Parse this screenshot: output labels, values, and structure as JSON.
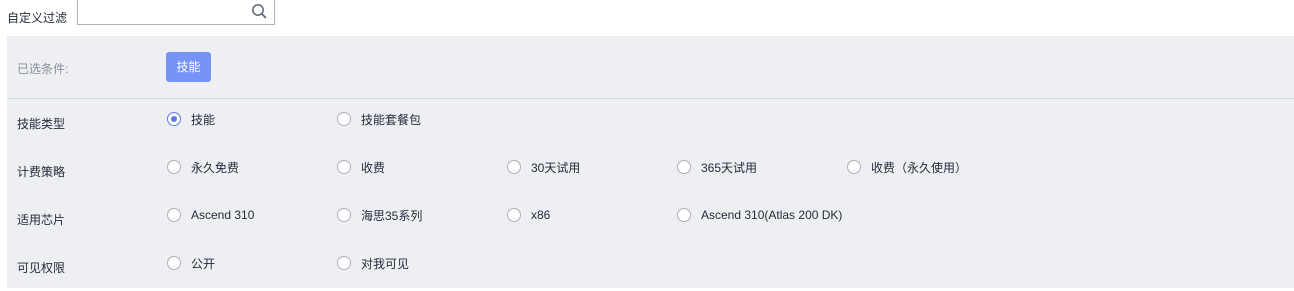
{
  "search": {
    "label": "自定义过滤",
    "value": "",
    "placeholder": "",
    "icon": "search-icon"
  },
  "selected": {
    "label": "已选条件:",
    "chips": [
      "技能"
    ],
    "chip_color": "#7693f5"
  },
  "accent_color": "#5e7ce0",
  "filters": [
    {
      "label": "技能类型",
      "options": [
        {
          "label": "技能",
          "checked": true
        },
        {
          "label": "技能套餐包",
          "checked": false
        }
      ]
    },
    {
      "label": "计费策略",
      "options": [
        {
          "label": "永久免费",
          "checked": false
        },
        {
          "label": "收费",
          "checked": false
        },
        {
          "label": "30天试用",
          "checked": false
        },
        {
          "label": "365天试用",
          "checked": false
        },
        {
          "label": "收费（永久使用）",
          "checked": false
        }
      ]
    },
    {
      "label": "适用芯片",
      "options": [
        {
          "label": "Ascend 310",
          "checked": false
        },
        {
          "label": "海思35系列",
          "checked": false
        },
        {
          "label": "x86",
          "checked": false
        },
        {
          "label": "Ascend 310(Atlas 200 DK)",
          "checked": false
        }
      ]
    },
    {
      "label": "可见权限",
      "options": [
        {
          "label": "公开",
          "checked": false
        },
        {
          "label": "对我可见",
          "checked": false
        }
      ]
    }
  ]
}
